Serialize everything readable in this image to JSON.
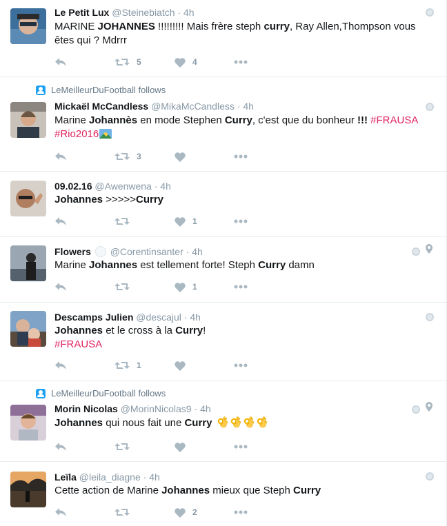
{
  "colors": {
    "hashtag": "#e0245e",
    "muted": "#8899a6",
    "icon": "#aab8c2",
    "badge": "#1da1f2"
  },
  "icons": [
    "reply-icon",
    "retweet-icon",
    "like-icon",
    "more-icon",
    "globe-icon",
    "location-pin-icon",
    "follow-context-icon"
  ],
  "tweets": [
    {
      "name": "Le Petit Lux",
      "handle": "@Steinebiatch",
      "sep": "·",
      "time": "4h",
      "text": [
        [
          "MARINE "
        ],
        [
          "JOHANNES",
          "b"
        ],
        [
          " !!!!!!!!! Mais frère steph "
        ],
        [
          "curry",
          "b"
        ],
        [
          ", Ray Allen,Thompson vous êtes qui ? Mdrrr"
        ]
      ],
      "retweets": "5",
      "likes": "4"
    },
    {
      "context": "LeMeilleurDuFootball follows",
      "name": "Mickaël McCandless",
      "handle": "@MikaMcCandless",
      "sep": "·",
      "time": "4h",
      "text": [
        [
          "Marine "
        ],
        [
          "Johannès",
          "b"
        ],
        [
          " en mode Stephen "
        ],
        [
          "Curry",
          "b"
        ],
        [
          ", c'est que du bonheur "
        ],
        [
          "!!!",
          "b"
        ],
        [
          " "
        ],
        [
          "#FRAUSA",
          "tag"
        ],
        [
          " "
        ],
        [
          "#Rio2016",
          "tag"
        ]
      ],
      "retweets": "3",
      "likes": ""
    },
    {
      "name": "09.02.16",
      "handle": "@Awenwena",
      "sep": "·",
      "time": "4h",
      "text": [
        [
          "Johannes",
          "b"
        ],
        [
          " >>>>>"
        ],
        [
          "Curry",
          "b"
        ]
      ],
      "retweets": "",
      "likes": "1"
    },
    {
      "name": "Flowers",
      "handle": "@Corentinsanter",
      "sep": "·",
      "time": "4h",
      "text": [
        [
          "Marine "
        ],
        [
          "Johannes",
          "b"
        ],
        [
          " est tellement forte! Steph "
        ],
        [
          "Curry",
          "b"
        ],
        [
          " damn"
        ]
      ],
      "retweets": "",
      "likes": "1"
    },
    {
      "name": "Descamps Julien",
      "handle": "@descajul",
      "sep": "·",
      "time": "4h",
      "text": [
        [
          "Johannes",
          "b"
        ],
        [
          " et le cross à la "
        ],
        [
          "Curry",
          "b"
        ],
        [
          "!"
        ],
        [
          "\n"
        ],
        [
          "#FRAUSA",
          "tag"
        ]
      ],
      "retweets": "1",
      "likes": ""
    },
    {
      "context": "LeMeilleurDuFootball follows",
      "name": "Morin Nicolas",
      "handle": "@MorinNicolas9",
      "sep": "·",
      "time": "4h",
      "text": [
        [
          "Johannes",
          "b"
        ],
        [
          " qui nous fait une "
        ],
        [
          "Curry",
          "b"
        ]
      ],
      "retweets": "",
      "likes": ""
    },
    {
      "name": "Leïla",
      "handle": "@leila_diagne",
      "sep": "·",
      "time": "4h",
      "text": [
        [
          "Cette action de Marine "
        ],
        [
          "Johannes",
          "b"
        ],
        [
          " mieux que Steph "
        ],
        [
          "Curry",
          "b"
        ]
      ],
      "retweets": "",
      "likes": "2"
    }
  ]
}
